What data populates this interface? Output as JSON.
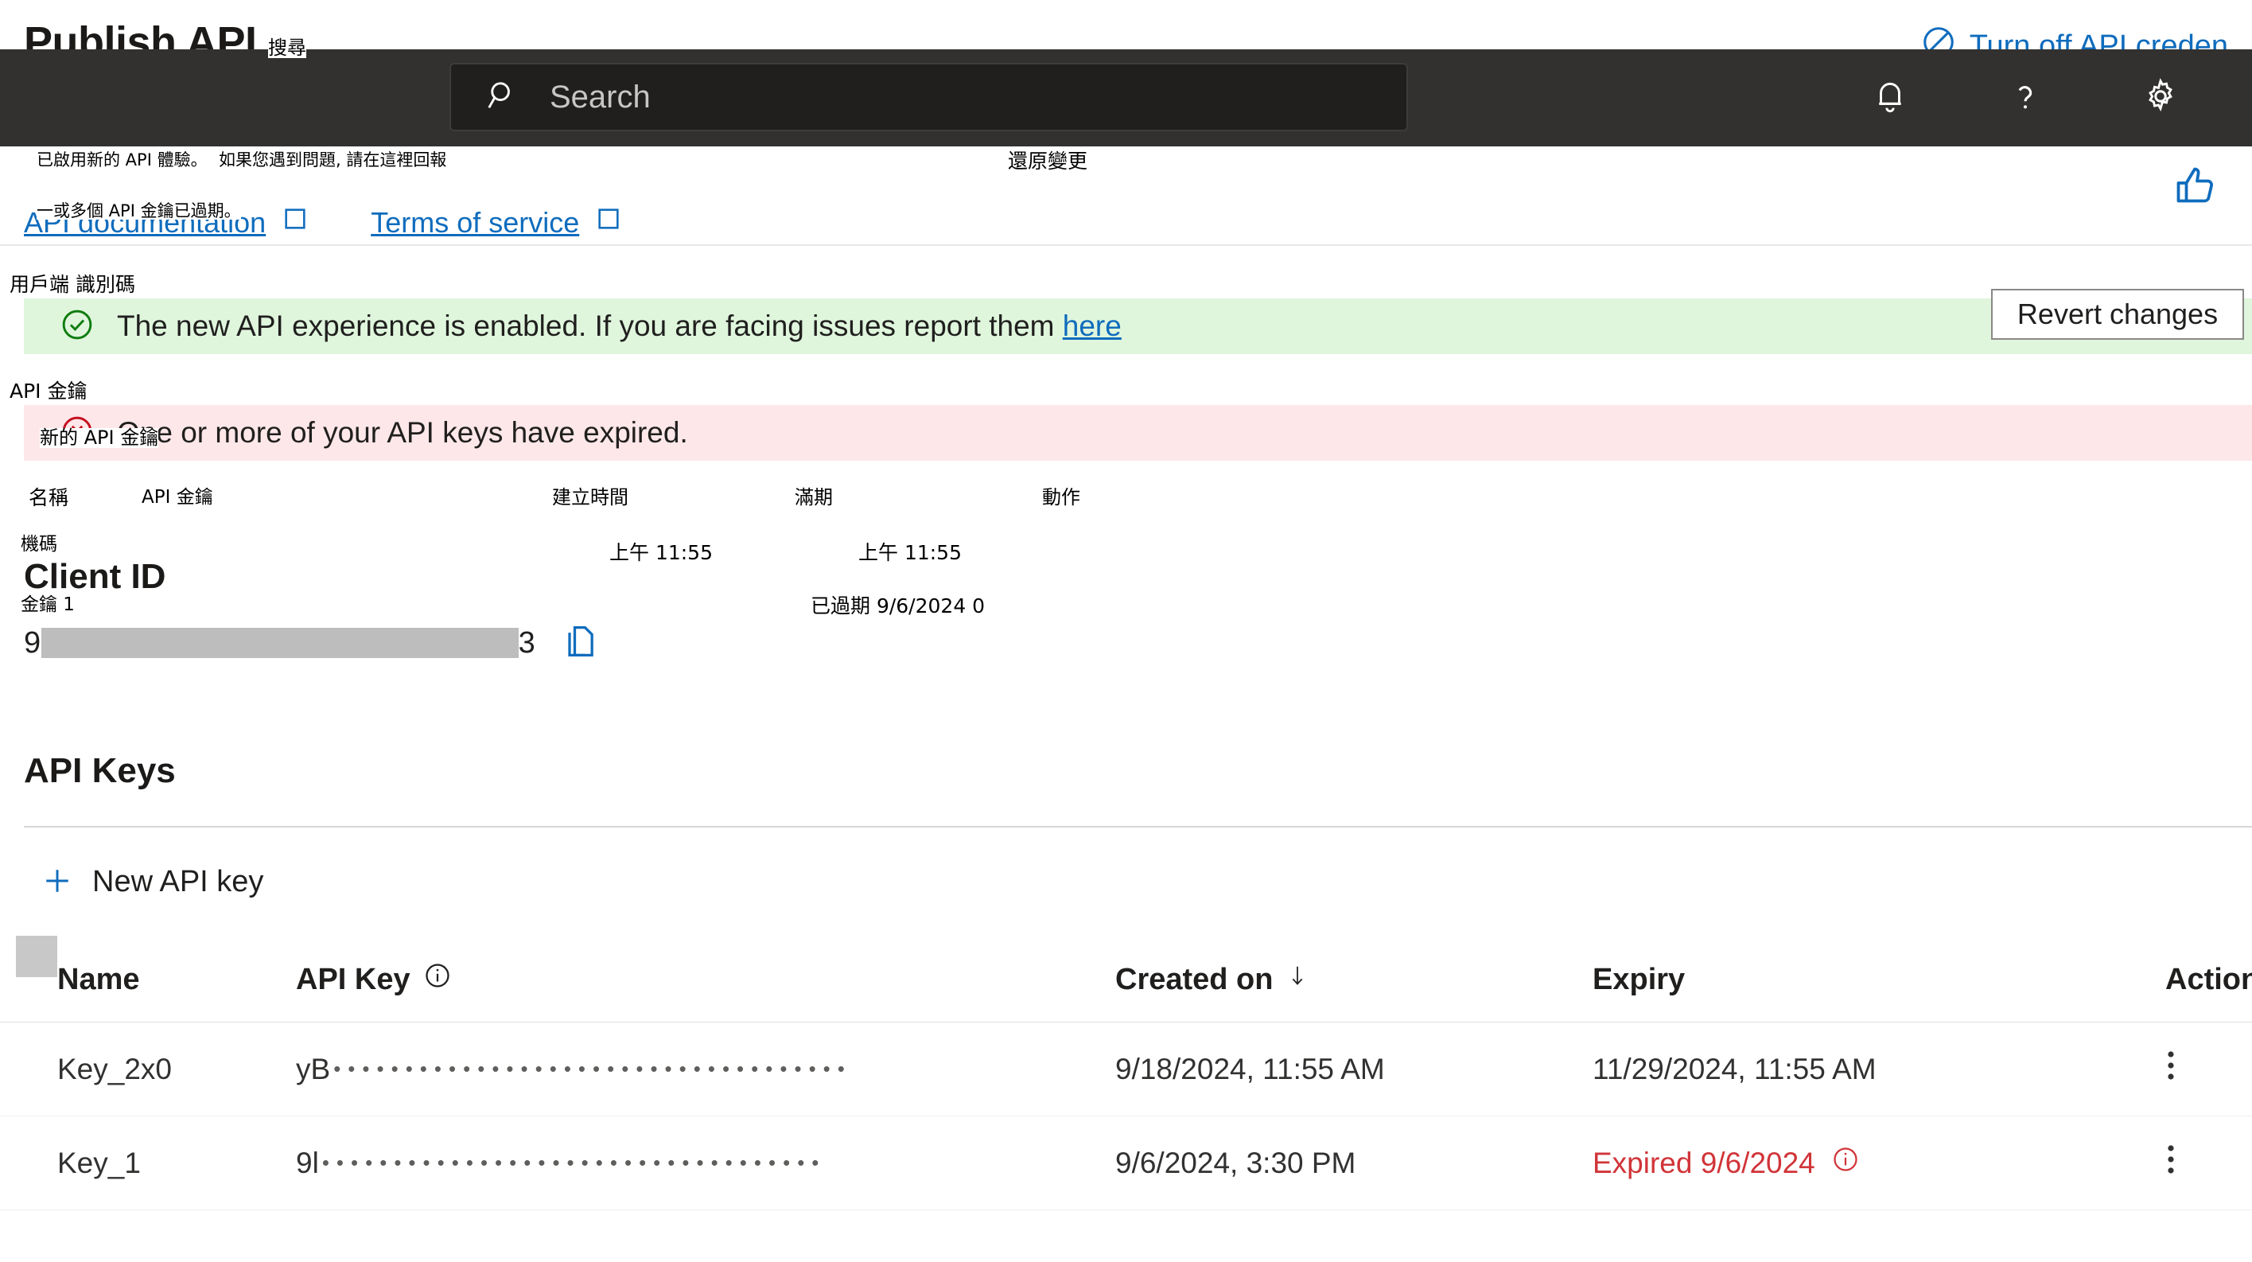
{
  "page": {
    "title": "Publish API",
    "turn_off_credentials": "Turn off API creden",
    "turn_off_icon": "prohibition-icon",
    "thumbs_up_icon": "thumbs-up-icon"
  },
  "doc_links": [
    {
      "label": "API documentation",
      "icon": "external-link-icon"
    },
    {
      "label": "Terms of service",
      "icon": "external-link-icon"
    }
  ],
  "banners": {
    "success": {
      "icon": "checkmark-circle-icon",
      "text": "The new API experience is enabled. If you are facing issues report them ",
      "link_text": "here",
      "action_label": "Revert changes",
      "bg_color": "#dff6dd"
    },
    "error": {
      "icon": "error-circle-icon",
      "text": "One or more of your API keys have expired.",
      "bg_color": "#fde7e9"
    }
  },
  "client_id": {
    "heading": "Client ID",
    "value_prefix": "9",
    "value_suffix": "3",
    "copy_icon": "copy-icon"
  },
  "api_keys_section": {
    "heading": "API Keys",
    "new_key_label": "New API key",
    "new_key_icon": "plus-icon"
  },
  "table": {
    "columns": [
      {
        "label": "Name",
        "icon": ""
      },
      {
        "label": "API Key",
        "icon": "info-icon"
      },
      {
        "label": "Created on",
        "icon": "sort-descending-arrow-icon"
      },
      {
        "label": "Expiry",
        "icon": ""
      },
      {
        "label": "Actions",
        "icon": ""
      }
    ],
    "rows": [
      {
        "name": "Key_2x0",
        "key_prefix": "yB",
        "key_mask": "••••••••••••••••••••••••••••••••••••",
        "created_on": "9/18/2024, 11:55 AM",
        "expiry": "11/29/2024, 11:55 AM",
        "expired": false,
        "actions_icon": "more-vertical-icon"
      },
      {
        "name": "Key_1",
        "key_prefix": "9l",
        "key_mask": "•••••••••••••••••••••••••••••••••••",
        "created_on": "9/6/2024, 3:30 PM",
        "expiry": "Expired 9/6/2024",
        "expired": true,
        "expiry_icon": "info-icon",
        "actions_icon": "more-vertical-icon"
      }
    ]
  },
  "overlay_bar": {
    "search_placeholder": "Search",
    "search_icon": "search-icon",
    "icons": [
      {
        "name": "bell-icon"
      },
      {
        "name": "question-mark-icon"
      },
      {
        "name": "gear-icon"
      }
    ]
  },
  "annotations": {
    "search_label": "搜尋",
    "new_api_experience": "已啟用新的 API 體驗。",
    "report_issue": "如果您遇到問題, 請在這裡回報",
    "revert_changes": "還原變更",
    "keys_expired": "一或多個 API 金鑰已過期。",
    "client_id_label": "用戶端 識別碼",
    "api_key_label": "API 金鑰",
    "new_api_key_label": "新的 API 金鑰",
    "col_name": "名稱",
    "col_api_key": "API 金鑰",
    "col_created": "建立時間",
    "col_expiry": "滿期",
    "col_actions": "動作",
    "machine_code": "機碼",
    "key_one": "金鑰 1",
    "time_1": "上午 11:55",
    "time_2": "上午 11:55",
    "expired_note": "已過期 9/6/2024 0"
  }
}
